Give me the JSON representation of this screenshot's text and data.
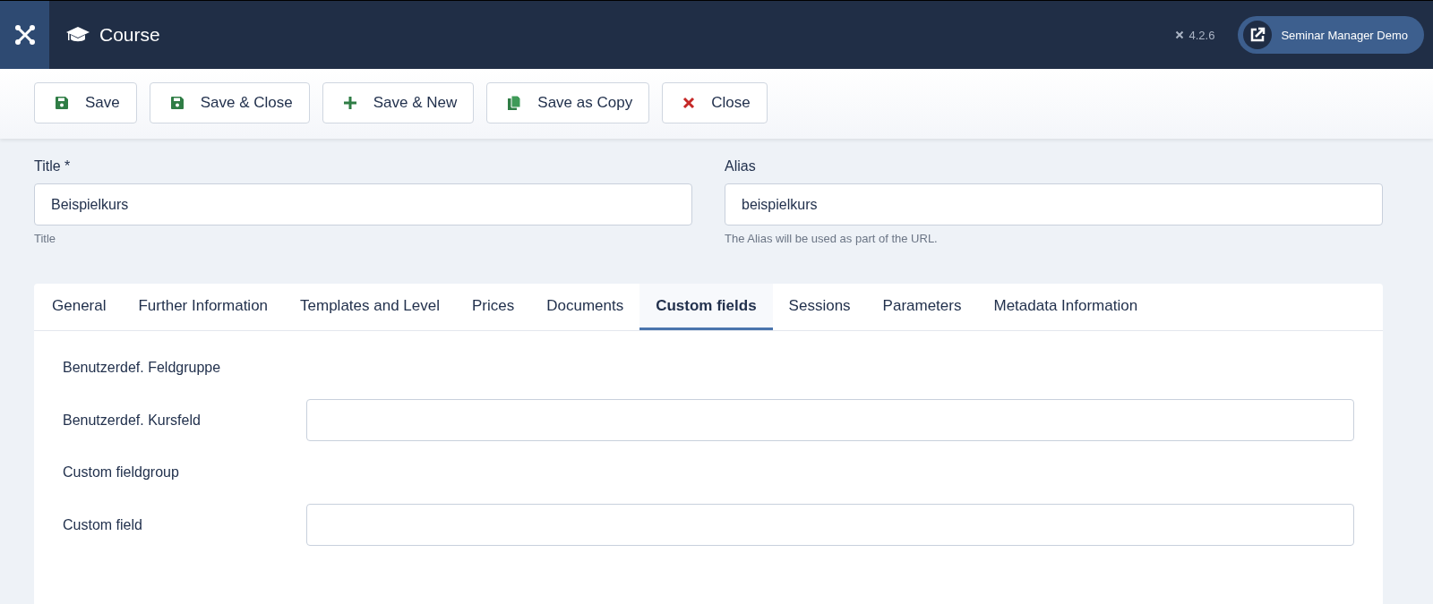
{
  "header": {
    "title": "Course",
    "version": "4.2.6",
    "site_button": "Seminar Manager Demo"
  },
  "toolbar": [
    {
      "label": "Save",
      "kind": "save"
    },
    {
      "label": "Save & Close",
      "kind": "save"
    },
    {
      "label": "Save & New",
      "kind": "new"
    },
    {
      "label": "Save as Copy",
      "kind": "copy"
    },
    {
      "label": "Close",
      "kind": "close"
    }
  ],
  "fields": [
    {
      "label": "Title *",
      "value": "Beispielkurs",
      "hint": "Title"
    },
    {
      "label": "Alias",
      "value": "beispielkurs",
      "hint": "The Alias will be used as part of the URL."
    }
  ],
  "tabs": [
    {
      "label": "General",
      "selected": false
    },
    {
      "label": "Further Information",
      "selected": false
    },
    {
      "label": "Templates and Level",
      "selected": false
    },
    {
      "label": "Prices",
      "selected": false
    },
    {
      "label": "Documents",
      "selected": false
    },
    {
      "label": "Custom fields",
      "selected": true
    },
    {
      "label": "Sessions",
      "selected": false
    },
    {
      "label": "Parameters",
      "selected": false
    },
    {
      "label": "Metadata Information",
      "selected": false
    }
  ],
  "rows": [
    {
      "kind": "group",
      "label": "Benutzerdef. Feldgruppe"
    },
    {
      "kind": "field",
      "label": "Benutzerdef. Kursfeld"
    },
    {
      "kind": "group",
      "label": "Custom fieldgroup"
    },
    {
      "kind": "field",
      "label": "Custom field"
    }
  ]
}
